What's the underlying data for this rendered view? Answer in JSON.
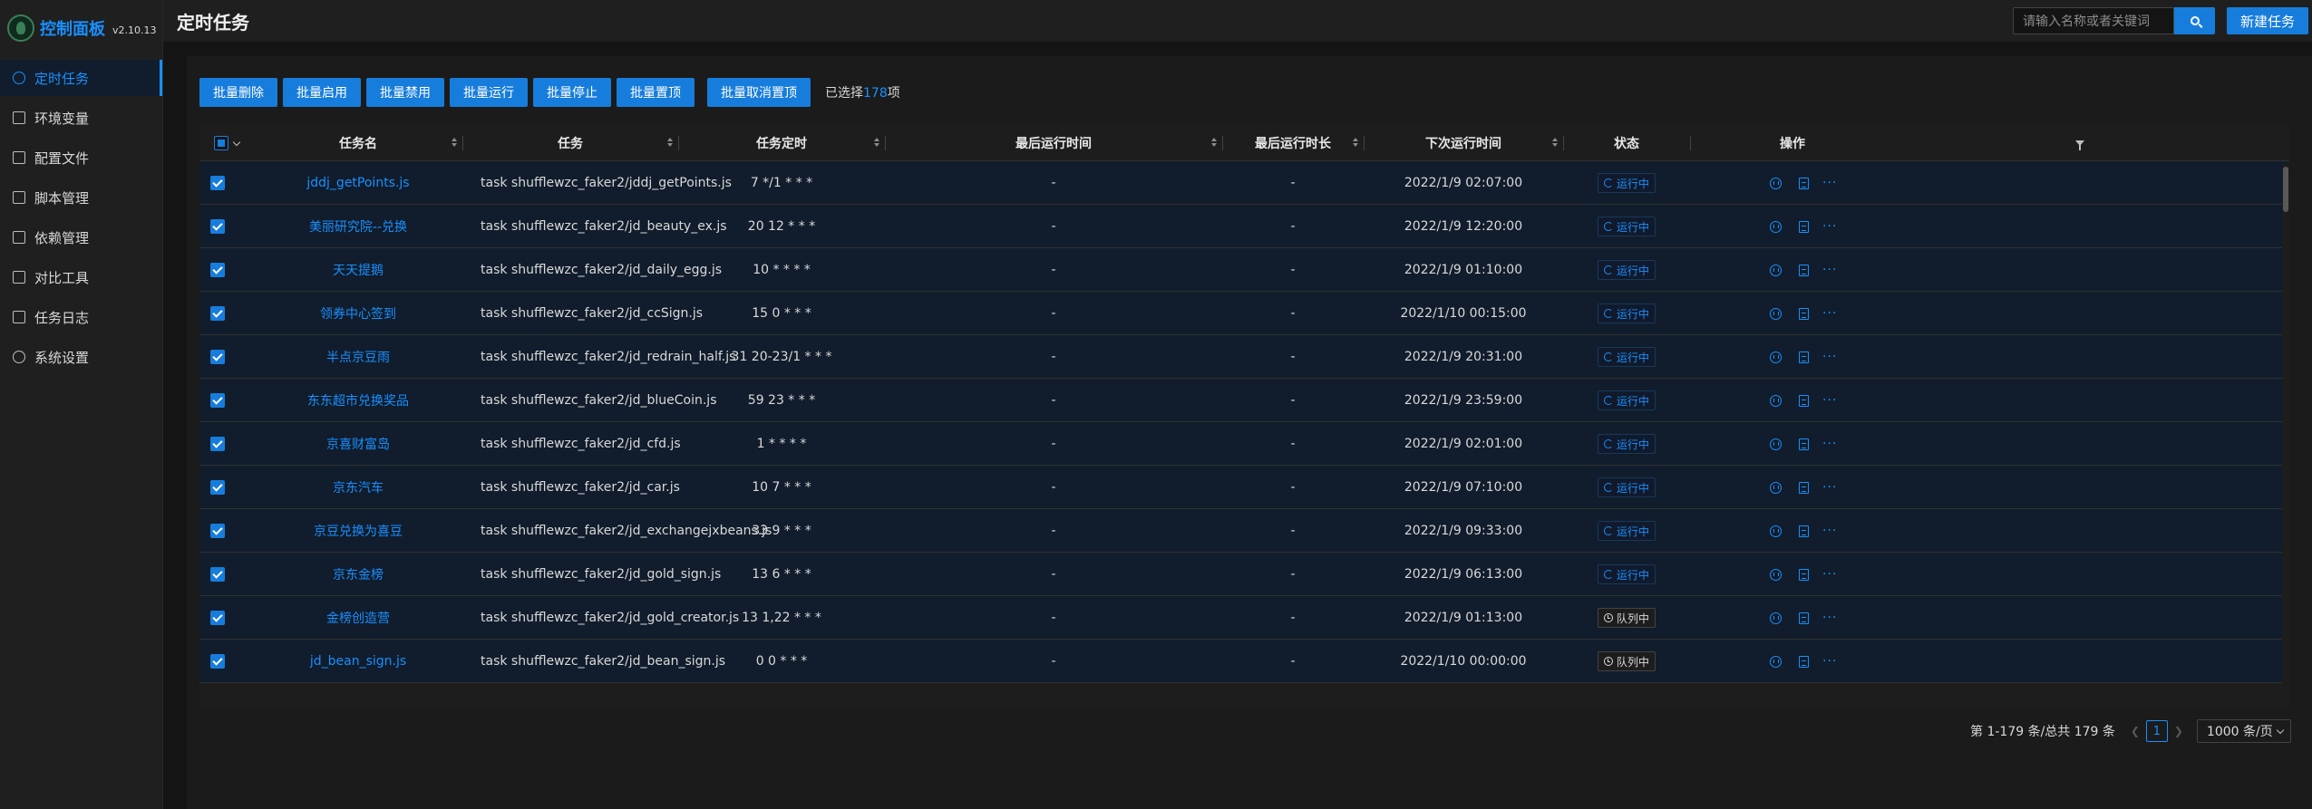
{
  "app": {
    "title": "控制面板",
    "version": "v2.10.13"
  },
  "sidebar": {
    "items": [
      {
        "label": "定时任务",
        "icon": "clock-icon",
        "active": true
      },
      {
        "label": "环境变量",
        "icon": "swap-icon"
      },
      {
        "label": "配置文件",
        "icon": "form-icon"
      },
      {
        "label": "脚本管理",
        "icon": "edit-icon"
      },
      {
        "label": "依赖管理",
        "icon": "database-icon"
      },
      {
        "label": "对比工具",
        "icon": "diff-icon"
      },
      {
        "label": "任务日志",
        "icon": "folder-icon"
      },
      {
        "label": "系统设置",
        "icon": "setting-icon"
      }
    ]
  },
  "header": {
    "title": "定时任务",
    "search_placeholder": "请输入名称或者关键词",
    "new_task_label": "新建任务"
  },
  "toolbar": {
    "buttons": [
      "批量删除",
      "批量启用",
      "批量禁用",
      "批量运行",
      "批量停止",
      "批量置顶",
      "批量取消置顶"
    ],
    "selected_prefix": "已选择",
    "selected_count": "178",
    "selected_suffix": "项"
  },
  "table": {
    "columns": [
      "任务名",
      "任务",
      "任务定时",
      "最后运行时间",
      "最后运行时长",
      "下次运行时间",
      "状态",
      "操作"
    ],
    "rows": [
      {
        "name": "jddj_getPoints.js",
        "command": "task shufflewzc_faker2/jddj_getPoints.js",
        "schedule": "7 */1 * * *",
        "last_run": "-",
        "last_duration": "-",
        "next_run": "2022/1/9 02:07:00",
        "status": "运行中",
        "status_type": "running"
      },
      {
        "name": "美丽研究院--兑换",
        "command": "task shufflewzc_faker2/jd_beauty_ex.js",
        "schedule": "20 12 * * *",
        "last_run": "-",
        "last_duration": "-",
        "next_run": "2022/1/9 12:20:00",
        "status": "运行中",
        "status_type": "running"
      },
      {
        "name": "天天提鹅",
        "command": "task shufflewzc_faker2/jd_daily_egg.js",
        "schedule": "10 * * * *",
        "last_run": "-",
        "last_duration": "-",
        "next_run": "2022/1/9 01:10:00",
        "status": "运行中",
        "status_type": "running"
      },
      {
        "name": "领券中心签到",
        "command": "task shufflewzc_faker2/jd_ccSign.js",
        "schedule": "15 0 * * *",
        "last_run": "-",
        "last_duration": "-",
        "next_run": "2022/1/10 00:15:00",
        "status": "运行中",
        "status_type": "running"
      },
      {
        "name": "半点京豆雨",
        "command": "task shufflewzc_faker2/jd_redrain_half.js",
        "schedule": "31 20-23/1 * * *",
        "last_run": "-",
        "last_duration": "-",
        "next_run": "2022/1/9 20:31:00",
        "status": "运行中",
        "status_type": "running"
      },
      {
        "name": "东东超市兑换奖品",
        "command": "task shufflewzc_faker2/jd_blueCoin.js",
        "schedule": "59 23 * * *",
        "last_run": "-",
        "last_duration": "-",
        "next_run": "2022/1/9 23:59:00",
        "status": "运行中",
        "status_type": "running"
      },
      {
        "name": "京喜财富岛",
        "command": "task shufflewzc_faker2/jd_cfd.js",
        "schedule": "1 * * * *",
        "last_run": "-",
        "last_duration": "-",
        "next_run": "2022/1/9 02:01:00",
        "status": "运行中",
        "status_type": "running"
      },
      {
        "name": "京东汽车",
        "command": "task shufflewzc_faker2/jd_car.js",
        "schedule": "10 7 * * *",
        "last_run": "-",
        "last_duration": "-",
        "next_run": "2022/1/9 07:10:00",
        "status": "运行中",
        "status_type": "running"
      },
      {
        "name": "京豆兑换为喜豆",
        "command": "task shufflewzc_faker2/jd_exchangejxbeans.js",
        "schedule": "33 9 * * *",
        "last_run": "-",
        "last_duration": "-",
        "next_run": "2022/1/9 09:33:00",
        "status": "运行中",
        "status_type": "running"
      },
      {
        "name": "京东金榜",
        "command": "task shufflewzc_faker2/jd_gold_sign.js",
        "schedule": "13 6 * * *",
        "last_run": "-",
        "last_duration": "-",
        "next_run": "2022/1/9 06:13:00",
        "status": "运行中",
        "status_type": "running"
      },
      {
        "name": "金榜创造营",
        "command": "task shufflewzc_faker2/jd_gold_creator.js",
        "schedule": "13 1,22 * * *",
        "last_run": "-",
        "last_duration": "-",
        "next_run": "2022/1/9 01:13:00",
        "status": "队列中",
        "status_type": "queued"
      },
      {
        "name": "jd_bean_sign.js",
        "command": "task shufflewzc_faker2/jd_bean_sign.js",
        "schedule": "0 0 * * *",
        "last_run": "-",
        "last_duration": "-",
        "next_run": "2022/1/10 00:00:00",
        "status": "队列中",
        "status_type": "queued"
      }
    ]
  },
  "pagination": {
    "summary": "第 1-179 条/总共 179 条",
    "current_page": "1",
    "page_size": "1000 条/页"
  },
  "colors": {
    "accent": "#177ddc",
    "link": "#1890ff",
    "row_selected_bg": "#111d2c",
    "background": "#141414"
  }
}
